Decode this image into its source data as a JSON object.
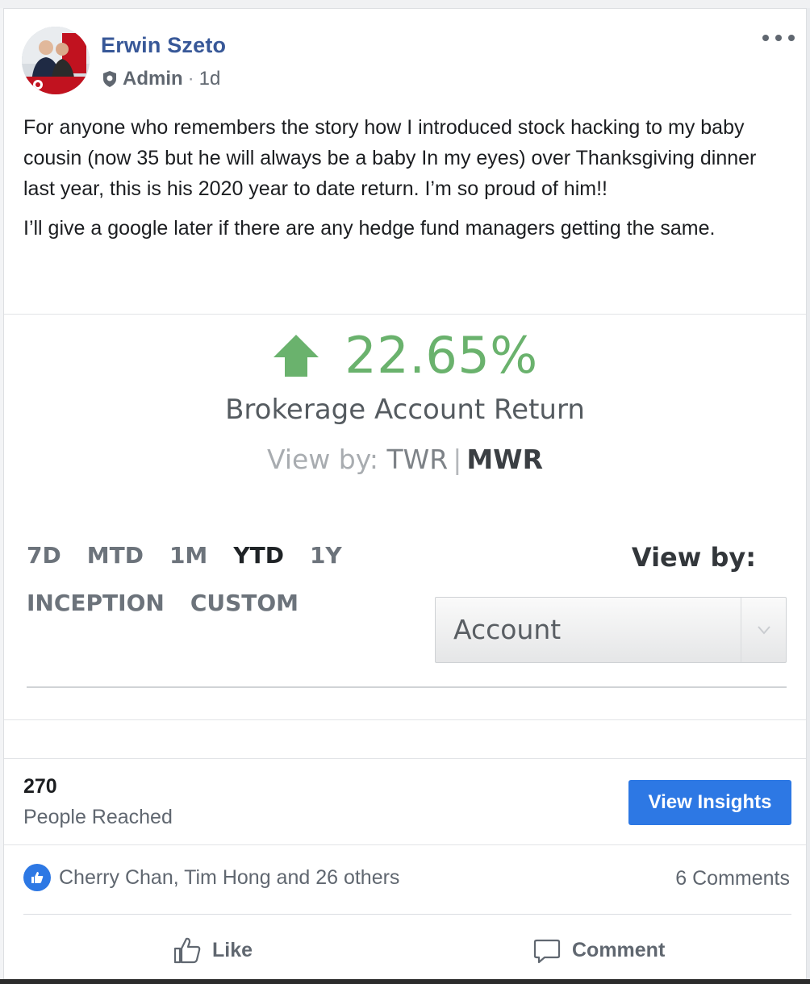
{
  "post": {
    "author": "Erwin Szeto",
    "role": "Admin",
    "separator": "·",
    "time": "1d",
    "paragraphs": [
      "For anyone who remembers the story how I introduced stock hacking to my baby cousin (now 35 but he will always be a baby In my eyes) over Thanksgiving dinner last year, this is his 2020 year to date return. I’m so proud of him!!",
      "I’ll give a google later if there are any hedge fund managers getting the same."
    ]
  },
  "attachment": {
    "return_value": "22.65%",
    "return_label": "Brokerage Account Return",
    "view_by_prefix": "View by:",
    "view_by_options": [
      "TWR",
      "MWR"
    ],
    "view_by_separator": "|",
    "view_by_active": "MWR",
    "periods_row1": [
      "7D",
      "MTD",
      "1M",
      "YTD",
      "1Y"
    ],
    "periods_row2": [
      "INCEPTION",
      "CUSTOM"
    ],
    "period_active": "YTD",
    "view_by_title": "View by:",
    "account_select_value": "Account",
    "accent_green": "#6ab26d"
  },
  "insights": {
    "people_reached_count": "270",
    "people_reached_label": "People Reached",
    "button_label": "View Insights",
    "button_color": "#2d78e4"
  },
  "engagement": {
    "reaction_icon": "like-thumb-icon",
    "reaction_names": "Cherry Chan, Tim Hong and 26 others",
    "comments_count": "6 Comments"
  },
  "actions": {
    "like_label": "Like",
    "comment_label": "Comment"
  }
}
